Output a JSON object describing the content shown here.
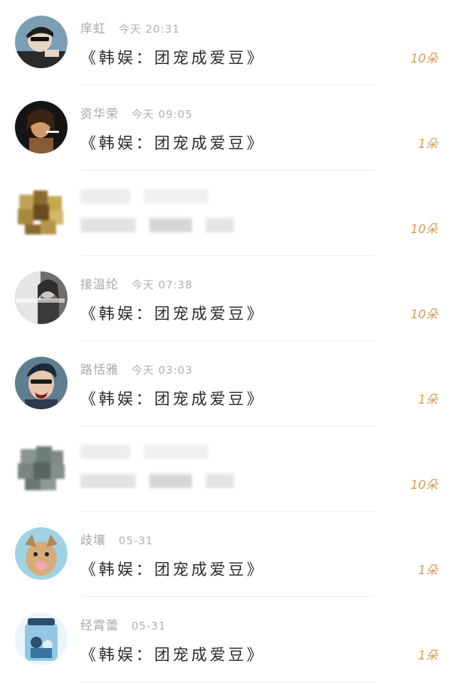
{
  "items": [
    {
      "name": "庠虹",
      "time": "今天 20:31",
      "message": "《韩娱：团宠成爱豆》",
      "gift": "10朵",
      "colors": [
        "#7a9fb5",
        "#1c1c1c",
        "#e7d6c4"
      ]
    },
    {
      "name": "资华荣",
      "time": "今天 09:05",
      "message": "《韩娱：团宠成爱豆》",
      "gift": "1朵",
      "colors": [
        "#151515",
        "#3a2414",
        "#e8b07a"
      ]
    },
    {
      "name": "",
      "time": "",
      "message": "",
      "gift": "10朵",
      "blurred": true,
      "colors": [
        "#a88a3c",
        "#6b4a22",
        "#d4b766"
      ]
    },
    {
      "name": "接温纶",
      "time": "今天 07:38",
      "message": "《韩娱：团宠成爱豆》",
      "gift": "10朵",
      "colors": [
        "#6e6e6e",
        "#e5e5e5",
        "#2e2e2e"
      ]
    },
    {
      "name": "路恬雅",
      "time": "今天 03:03",
      "message": "《韩娱：团宠成爱豆》",
      "gift": "1朵",
      "colors": [
        "#5f7e92",
        "#1b2a3a",
        "#e7c8b0"
      ]
    },
    {
      "name": "",
      "time": "",
      "message": "",
      "gift": "10朵",
      "blurred": true,
      "colors": [
        "#6f7d78",
        "#8b968f",
        "#59645f"
      ]
    },
    {
      "name": "歧壤",
      "time": "05-31",
      "message": "《韩娱：团宠成爱豆》",
      "gift": "1朵",
      "colors": [
        "#9ed3e6",
        "#d6ad7a",
        "#f2a7b4"
      ]
    },
    {
      "name": "经霄蕾",
      "time": "05-31",
      "message": "《韩娱：团宠成爱豆》",
      "gift": "1朵",
      "colors": [
        "#eaf6fb",
        "#4a9fd0",
        "#2a4e6c"
      ]
    }
  ]
}
